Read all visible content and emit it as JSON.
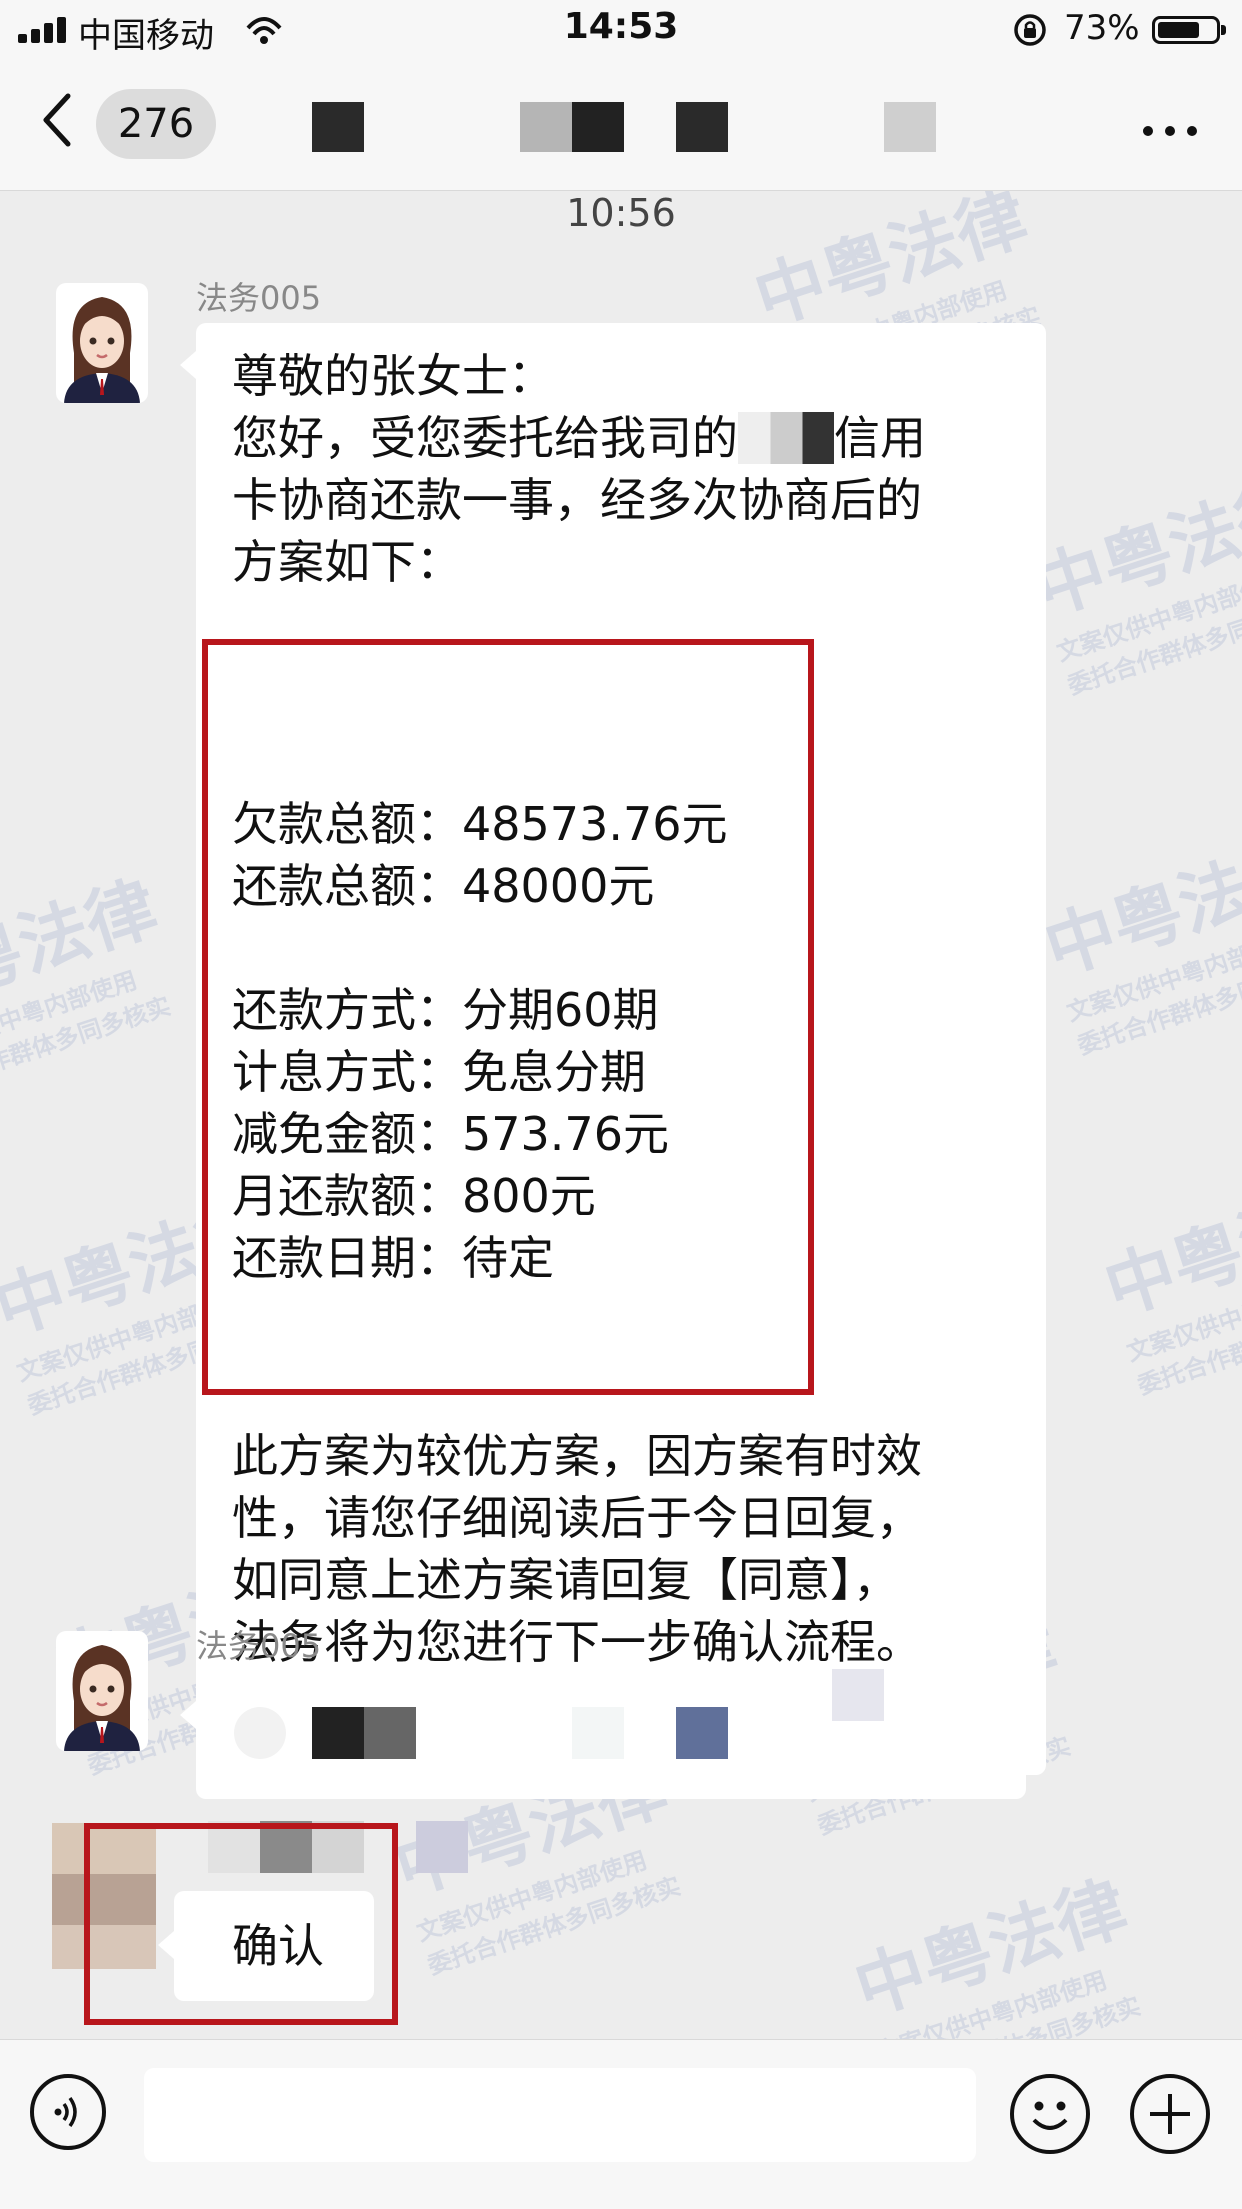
{
  "status_bar": {
    "carrier": "中国移动",
    "time": "14:53",
    "battery": "73%",
    "battery_level": 0.73,
    "icons": [
      "signal-icon",
      "wifi-icon",
      "rotation-lock-icon",
      "battery-icon"
    ]
  },
  "nav": {
    "back_icon": "chevron-left-icon",
    "unread_count": "276",
    "more_icon": "ellipsis-icon"
  },
  "chat": {
    "timestamp": "10:56",
    "messages": [
      {
        "sender": "法务005",
        "greeting": "尊敬的张女士：",
        "intro_line1_a": "您好，受您委托给我司的",
        "intro_line1_b": "信用",
        "intro_line2": "卡协商还款一事，经多次协商后的",
        "intro_line3": "方案如下：",
        "plan": [
          {
            "label": "欠款总额：",
            "value": "48573.76元"
          },
          {
            "label": "还款总额：",
            "value": "48000元"
          },
          {
            "label": "还款方式：",
            "value": "分期60期"
          },
          {
            "label": "计息方式：",
            "value": "免息分期"
          },
          {
            "label": "减免金额：",
            "value": "573.76元"
          },
          {
            "label": "月还款额：",
            "value": "800元"
          },
          {
            "label": "还款日期：",
            "value": "待定"
          }
        ],
        "closing": [
          "此方案为较优方案，因方案有时效",
          "性，请您仔细阅读后于今日回复，",
          "如同意上述方案请回复【同意】，",
          "法务将为您进行下一步确认流程。"
        ]
      },
      {
        "sender": "法务005"
      },
      {
        "reply": "确认"
      }
    ]
  },
  "watermark": {
    "title": "中粤法律",
    "line1": "文案仅供中粤内部使用",
    "line2": "委托合作群体多同多核实"
  },
  "colors": {
    "highlight": "#b8161c",
    "background": "#ededed",
    "bubble": "#ffffff"
  },
  "input_bar": {
    "icons": [
      "voice-icon",
      "emoji-icon",
      "plus-icon"
    ]
  }
}
